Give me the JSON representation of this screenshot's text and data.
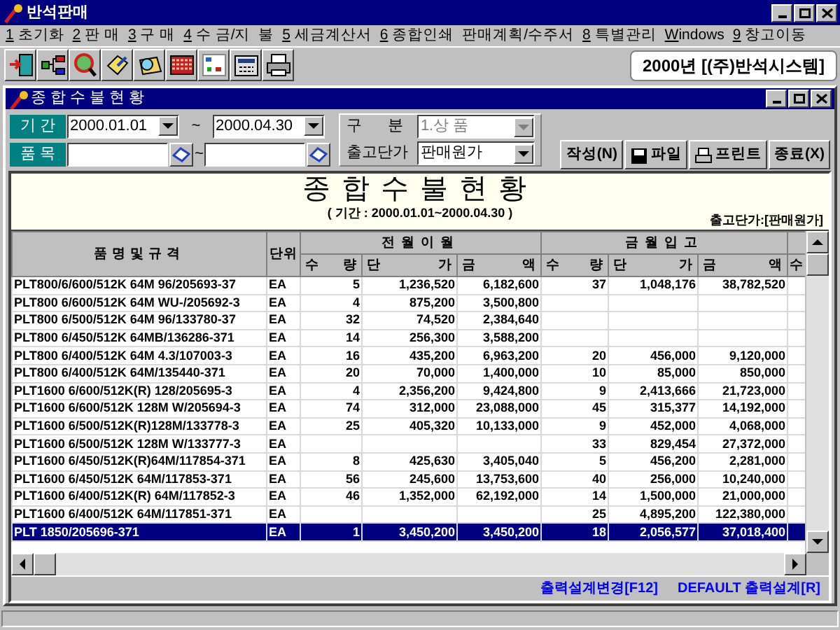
{
  "window": {
    "title": "반석판매"
  },
  "menu": [
    {
      "key": "1",
      "label": " 초기화"
    },
    {
      "key": "2",
      "label": " 판 매"
    },
    {
      "key": "3",
      "label": " 구 매"
    },
    {
      "key": "4",
      "label": " 수 금/지  불"
    },
    {
      "key": "5",
      "label": " 세금계산서"
    },
    {
      "key": "6",
      "label": " 종합인쇄"
    },
    {
      "label": "판매계획/수주서"
    },
    {
      "key": "8",
      "label": " 특별관리"
    },
    {
      "key": "W",
      "label": "indows"
    },
    {
      "key": "9",
      "label": " 창고이동"
    }
  ],
  "toolbar": [
    {
      "kind": "exit"
    },
    {
      "kind": "tree"
    },
    {
      "kind": "globe"
    },
    {
      "kind": "notebook"
    },
    {
      "kind": "search"
    },
    {
      "kind": "abacus"
    },
    {
      "kind": "calendar"
    },
    {
      "kind": "calculator"
    },
    {
      "kind": "printer"
    }
  ],
  "company_label": "2000년 [(주)반석시스템]",
  "child_window": {
    "title": "종합수불현황"
  },
  "filters": {
    "period_label": "기 간",
    "date_from": "2000.01.01",
    "date_sep": "~",
    "date_to": "2000.04.30",
    "item_label": "품 목",
    "item_sep": "~",
    "category_label": "구      분",
    "category_value": "1.상 품",
    "category_disabled": true,
    "price_label": "출고단가",
    "price_value": "판매원가"
  },
  "buttons": [
    {
      "label": "작성(N)",
      "kind": "text"
    },
    {
      "label": "파일",
      "kind": "disk"
    },
    {
      "label": "프린트",
      "kind": "printer"
    },
    {
      "label": "종료(X)",
      "kind": "text"
    }
  ],
  "report": {
    "title": "종합수불현황",
    "period": "( 기간 : 2000.01.01~2000.04.30 )",
    "price_note": "출고단가:[판매원가]"
  },
  "table": {
    "name_header": "품명및규격",
    "unit_header": "단위",
    "groups": [
      "전월이월",
      "금월입고"
    ],
    "sub_headers": [
      "수 량",
      "단 가",
      "금 액",
      "수 량",
      "단 가",
      "금 액"
    ],
    "cut_header": "수",
    "rows": [
      {
        "name": "PLT800/6/600/512K 64M 96/205693-37",
        "unit": "EA",
        "prev_qty": "5",
        "prev_price": "1,236,520",
        "prev_amount": "6,182,600",
        "in_qty": "37",
        "in_price": "1,048,176",
        "in_amount": "38,782,520",
        "selected": false
      },
      {
        "name": "PLT800 6/600/512K 64M WU-/205692-3",
        "unit": "EA",
        "prev_qty": "4",
        "prev_price": "875,200",
        "prev_amount": "3,500,800",
        "selected": false
      },
      {
        "name": "PLT800 6/500/512K 64M 96/133780-37",
        "unit": "EA",
        "prev_qty": "32",
        "prev_price": "74,520",
        "prev_amount": "2,384,640",
        "selected": false
      },
      {
        "name": "PLT800 6/450/512K 64MB/136286-371",
        "unit": "EA",
        "prev_qty": "14",
        "prev_price": "256,300",
        "prev_amount": "3,588,200",
        "selected": false
      },
      {
        "name": "PLT800 6/400/512K 64M 4.3/107003-3",
        "unit": "EA",
        "prev_qty": "16",
        "prev_price": "435,200",
        "prev_amount": "6,963,200",
        "in_qty": "20",
        "in_price": "456,000",
        "in_amount": "9,120,000",
        "selected": false
      },
      {
        "name": "PLT800 6/400/512K 64M/135440-371",
        "unit": "EA",
        "prev_qty": "20",
        "prev_price": "70,000",
        "prev_amount": "1,400,000",
        "in_qty": "10",
        "in_price": "85,000",
        "in_amount": "850,000",
        "selected": false
      },
      {
        "name": "PLT1600 6/600/512K(R) 128/205695-3",
        "unit": "EA",
        "prev_qty": "4",
        "prev_price": "2,356,200",
        "prev_amount": "9,424,800",
        "in_qty": "9",
        "in_price": "2,413,666",
        "in_amount": "21,723,000",
        "selected": false
      },
      {
        "name": "PLT1600 6/600/512K 128M W/205694-3",
        "unit": "EA",
        "prev_qty": "74",
        "prev_price": "312,000",
        "prev_amount": "23,088,000",
        "in_qty": "45",
        "in_price": "315,377",
        "in_amount": "14,192,000",
        "selected": false
      },
      {
        "name": "PLT1600 6/500/512K(R)128M/133778-3",
        "unit": "EA",
        "prev_qty": "25",
        "prev_price": "405,320",
        "prev_amount": "10,133,000",
        "in_qty": "9",
        "in_price": "452,000",
        "in_amount": "4,068,000",
        "selected": false
      },
      {
        "name": "PLT1600 6/500/512K 128M W/133777-3",
        "unit": "EA",
        "in_qty": "33",
        "in_price": "829,454",
        "in_amount": "27,372,000",
        "selected": false
      },
      {
        "name": "PLT1600 6/450/512K(R)64M/117854-371",
        "unit": "EA",
        "prev_qty": "8",
        "prev_price": "425,630",
        "prev_amount": "3,405,040",
        "in_qty": "5",
        "in_price": "456,200",
        "in_amount": "2,281,000",
        "selected": false
      },
      {
        "name": "PLT1600 6/450/512K 64M/117853-371",
        "unit": "EA",
        "prev_qty": "56",
        "prev_price": "245,600",
        "prev_amount": "13,753,600",
        "in_qty": "40",
        "in_price": "256,000",
        "in_amount": "10,240,000",
        "selected": false
      },
      {
        "name": "PLT1600 6/400/512K(R) 64M/117852-3",
        "unit": "EA",
        "prev_qty": "46",
        "prev_price": "1,352,000",
        "prev_amount": "62,192,000",
        "in_qty": "14",
        "in_price": "1,500,000",
        "in_amount": "21,000,000",
        "selected": false
      },
      {
        "name": "PLT1600 6/400/512K 64M/117851-371",
        "unit": "EA",
        "in_qty": "25",
        "in_price": "4,895,200",
        "in_amount": "122,380,000",
        "selected": false
      },
      {
        "name": "PLT 1850/205696-371",
        "unit": "EA",
        "prev_qty": "1",
        "prev_price": "3,450,200",
        "prev_amount": "3,450,200",
        "in_qty": "18",
        "in_price": "2,056,577",
        "in_amount": "37,018,400",
        "selected": true
      }
    ]
  },
  "footer_links": [
    "출력설계변경[F12]",
    "DEFAULT 출력설계[R]"
  ]
}
